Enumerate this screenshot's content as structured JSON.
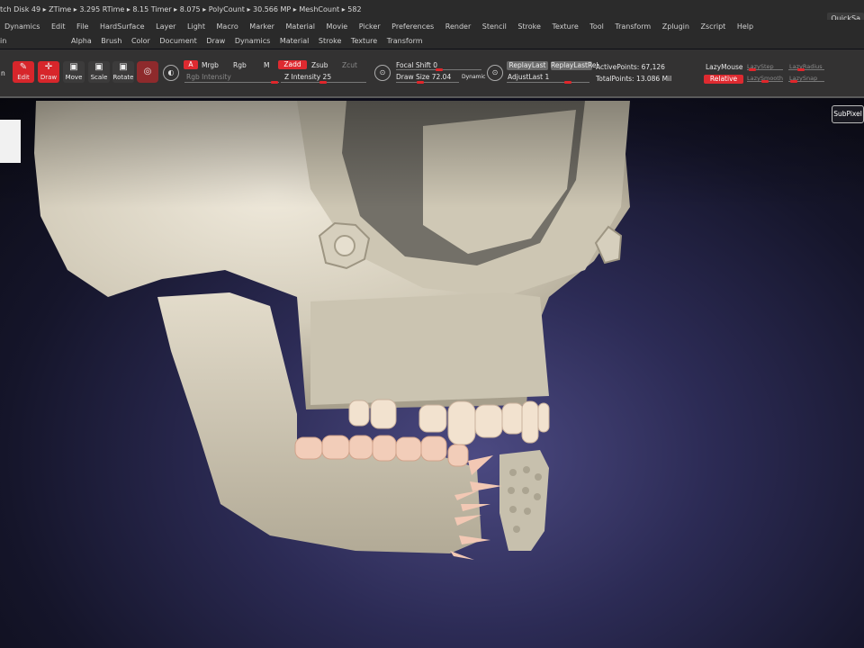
{
  "status_bar": {
    "text": "tch Disk 49 ▸ ZTime ▸ 3.295 RTime ▸ 8.15 Timer ▸ 8.075 ▸ PolyCount ▸ 30.566 MP ▸ MeshCount ▸ 582",
    "quicksave": "QuickSa"
  },
  "menu_row1": [
    "Dynamics",
    "Edit",
    "File",
    "HardSurface",
    "Layer",
    "Light",
    "Macro",
    "Marker",
    "Material",
    "Movie",
    "Picker",
    "Preferences",
    "Render",
    "Stencil",
    "Stroke",
    "Texture",
    "Tool",
    "Transform",
    "Zplugin",
    "Zscript",
    "Help"
  ],
  "menu_row2_label": "in",
  "menu_row2": [
    "Alpha",
    "Brush",
    "Color",
    "Document",
    "Draw",
    "Dynamics",
    "Material",
    "Stroke",
    "Texture",
    "Transform"
  ],
  "toolbar": {
    "left_label": "n",
    "edit": "Edit",
    "draw": "Draw",
    "move": "Move",
    "scale": "Scale",
    "rotate": "Rotate",
    "a_button": "A",
    "mrgb": "Mrgb",
    "rgb": "Rgb",
    "m": "M",
    "zadd": "Zadd",
    "zsub": "Zsub",
    "zcut": "Zcut",
    "rgb_intensity": "Rgb Intensity",
    "z_intensity": "Z Intensity 25",
    "focal_shift": "Focal Shift 0",
    "draw_size": "Draw Size 72.04",
    "dynamic": "Dynamic",
    "replay_last": "ReplayLast",
    "replay_last_rel": "ReplayLastRel",
    "adjust_last": "AdjustLast 1",
    "active_points": "ActivePoints: 67,126",
    "total_points": "TotalPoints: 13.086 Mil",
    "lazy_mouse": "LazyMouse",
    "relative": "Relative",
    "lazy_step": "LazyStep",
    "lazy_smooth": "LazySmooth",
    "lazy_radius": "LazyRadius",
    "lazy_snap": "LazySnap"
  },
  "viewport": {
    "subpixel": "SubPixel"
  },
  "colors": {
    "accent_red": "#de2a30",
    "model_bone": "#d8d2c2",
    "teeth": "#f2cdb9"
  }
}
